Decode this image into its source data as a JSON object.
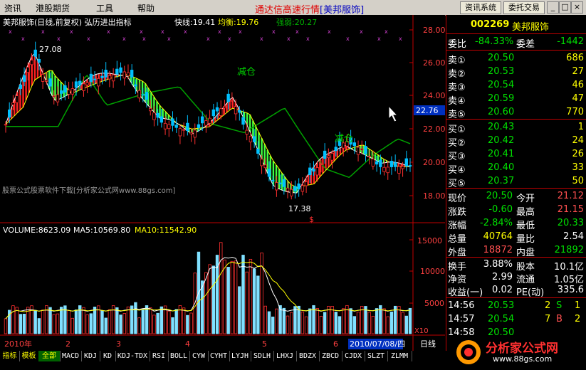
{
  "menu": {
    "items": [
      "资讯",
      "港股期货",
      "工具",
      "帮助"
    ],
    "app_title": "通达信高速行情",
    "stock_bracket": "[美邦服饰]",
    "btn_news": "资讯系统",
    "btn_trade": "委托交易",
    "win_min": "_",
    "win_max": "□",
    "win_close": "×"
  },
  "chart": {
    "header_name": "美邦服饰(日线,前复权) 弘历进出指标",
    "fast_label": "快线:19.41",
    "avg_label": "均衡:19.76",
    "strength_label": "强弱:20.27",
    "price_ticks": [
      "28.00",
      "26.00",
      "24.00",
      "22.00",
      "20.00",
      "18.00"
    ],
    "current_price_tag": "22.76",
    "high_label": "27.08",
    "low_label": "17.38",
    "ann_reduce1": "减仓",
    "ann_reduce2": "减仓",
    "watermark": "股票公式股票软件下载[分析家公式网www.88gs.com]",
    "dollar_mark": "$",
    "volume_header": "VOLUME:8623.09",
    "ma5_label": "MA5:10569.80",
    "ma10_label": "MA10:11542.90",
    "vol_ticks": [
      "15000",
      "10000",
      "5000"
    ],
    "vol_unit": "X10",
    "date_axis": [
      "2010年",
      "2",
      "3",
      "4",
      "5",
      "6"
    ],
    "date_box": "2010/07/08/四",
    "period": "日线"
  },
  "chart_data": {
    "type": "candlestick",
    "series_colors": {
      "up": "#ff4040",
      "down": "#00c0ff",
      "fast": "#ffffff",
      "avg": "#ffff00",
      "strength": "#00a000"
    },
    "ylim": [
      17,
      29
    ],
    "vol_ylim": [
      0,
      16000
    ]
  },
  "quote": {
    "code": "002269",
    "name": "美邦服饰",
    "weibi_label": "委比",
    "weibi_val": "-84.33%",
    "weicha_label": "委差",
    "weicha_val": "-1442",
    "sells": [
      {
        "label": "卖⑤",
        "price": "20.60",
        "vol": "770"
      },
      {
        "label": "卖④",
        "price": "20.59",
        "vol": "47"
      },
      {
        "label": "卖③",
        "price": "20.54",
        "vol": "46"
      },
      {
        "label": "卖②",
        "price": "20.53",
        "vol": "27"
      },
      {
        "label": "卖①",
        "price": "20.50",
        "vol": "686"
      }
    ],
    "buys": [
      {
        "label": "买①",
        "price": "20.43",
        "vol": "1"
      },
      {
        "label": "买②",
        "price": "20.42",
        "vol": "24"
      },
      {
        "label": "买③",
        "price": "20.41",
        "vol": "26"
      },
      {
        "label": "买④",
        "price": "20.40",
        "vol": "33"
      },
      {
        "label": "买⑤",
        "price": "20.37",
        "vol": "50"
      }
    ],
    "stats": [
      {
        "l1": "现价",
        "v1": "20.50",
        "l2": "今开",
        "v2": "21.12"
      },
      {
        "l1": "涨跌",
        "v1": "-0.60",
        "l2": "最高",
        "v2": "21.15"
      },
      {
        "l1": "涨幅",
        "v1": "-2.84%",
        "l2": "最低",
        "v2": "20.33"
      },
      {
        "l1": "总量",
        "v1": "40764",
        "l2": "量比",
        "v2": "2.54"
      },
      {
        "l1": "外盘",
        "v1": "18872",
        "l2": "内盘",
        "v2": "21892"
      }
    ],
    "fin": [
      {
        "l1": "换手",
        "v1": "3.88%",
        "l2": "股本",
        "v2": "10.1亿"
      },
      {
        "l1": "净资",
        "v1": "2.99",
        "l2": "流通",
        "v2": "1.05亿"
      },
      {
        "l1": "收益(一)",
        "v1": "0.02",
        "l2": "PE(动)",
        "v2": "335.6"
      }
    ],
    "ticks": [
      {
        "time": "14:56",
        "price": "20.53",
        "vol": "2",
        "side": "S",
        "n": "1"
      },
      {
        "time": "14:57",
        "price": "20.54",
        "vol": "7",
        "side": "B",
        "n": "2"
      },
      {
        "time": "14:58",
        "price": "20.50",
        "vol": "",
        "side": "",
        "n": ""
      }
    ]
  },
  "tabs": [
    "指标",
    "模板",
    "全部",
    "MACD",
    "KDJ",
    "KD",
    "KDJ-TDX",
    "RSI",
    "BOLL",
    "CYW",
    "CYHT",
    "LYJH",
    "SDLH",
    "LHXJ",
    "BDZX",
    "ZBCD",
    "CJDX",
    "SLZT",
    "ZLMM"
  ],
  "brand": {
    "logo_text": "分析家公式网",
    "url": "www.88gs.com"
  }
}
